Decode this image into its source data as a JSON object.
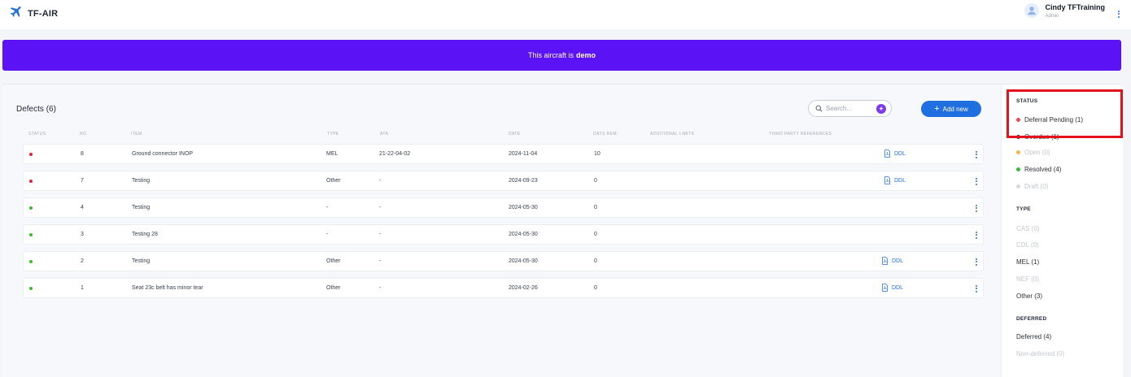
{
  "app": {
    "name": "TF-AIR",
    "logo_icon": "airplane-icon"
  },
  "user": {
    "name": "Cindy TFTraining",
    "role": "Admin"
  },
  "banner": {
    "prefix": "This aircraft is",
    "status": "demo",
    "color": "#5b12f5"
  },
  "defects": {
    "title": "Defects",
    "count": "(6)",
    "search_placeholder": "Search...",
    "add_label": "Add new",
    "columns": [
      "STATUS",
      "NO.",
      "ITEM",
      "TYPE",
      "ATA",
      "DATE",
      "DAYS REM.",
      "ADDITIONAL LIMITS",
      "THIRD PARTY REFERENCES"
    ],
    "rows": [
      {
        "status_color": "#e5222e",
        "no": "8",
        "item": "Ground connector INOP",
        "type": "MEL",
        "ata": "21-22-04-02",
        "date": "2024-11-04",
        "days": "10",
        "ddl": "DDL"
      },
      {
        "status_color": "#e5222e",
        "no": "7",
        "item": "Testing",
        "type": "Other",
        "ata": "-",
        "date": "2024-09-23",
        "days": "0",
        "ddl": "DDL"
      },
      {
        "status_color": "#3dba2f",
        "no": "4",
        "item": "Testing",
        "type": "-",
        "ata": "-",
        "date": "2024-05-30",
        "days": "0",
        "ddl": ""
      },
      {
        "status_color": "#3dba2f",
        "no": "3",
        "item": "Testing 28",
        "type": "-",
        "ata": "-",
        "date": "2024-05-30",
        "days": "0",
        "ddl": ""
      },
      {
        "status_color": "#3dba2f",
        "no": "2",
        "item": "Testing",
        "type": "Other",
        "ata": "-",
        "date": "2024-05-30",
        "days": "0",
        "ddl": "DDL"
      },
      {
        "status_color": "#3dba2f",
        "no": "1",
        "item": "Seat 23c belt has minor tear",
        "type": "Other",
        "ata": "-",
        "date": "2024-02-26",
        "days": "0",
        "ddl": "DDL"
      }
    ]
  },
  "filters": {
    "status": {
      "heading": "STATUS",
      "items": [
        {
          "label": "Deferral Pending (1)",
          "color": "#f04a55",
          "dim": false
        },
        {
          "label": "Overdue (1)",
          "color": "#2b2f36",
          "dim": false
        },
        {
          "label": "Open (0)",
          "color": "#f5b64a",
          "dim": true
        },
        {
          "label": "Resolved (4)",
          "color": "#3dba2f",
          "dim": false
        },
        {
          "label": "Draft (0)",
          "color": "#d6d9de",
          "dim": true
        }
      ]
    },
    "type": {
      "heading": "TYPE",
      "items": [
        {
          "label": "CAS (0)",
          "dim": true
        },
        {
          "label": "CDL (0)",
          "dim": true
        },
        {
          "label": "MEL (1)",
          "dim": false
        },
        {
          "label": "NEF (0)",
          "dim": true
        },
        {
          "label": "Other (3)",
          "dim": false
        }
      ]
    },
    "deferred": {
      "heading": "DEFERRED",
      "items": [
        {
          "label": "Deferred (4)",
          "dim": false
        },
        {
          "label": "Non-deferred (0)",
          "dim": true
        }
      ]
    }
  }
}
